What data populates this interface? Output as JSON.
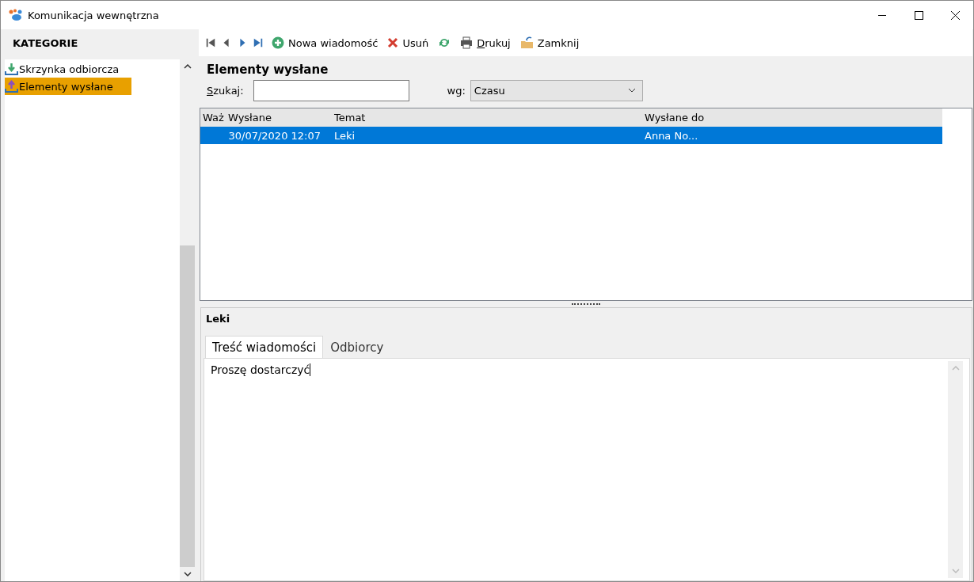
{
  "window": {
    "title": "Komunikacja wewnętrzna"
  },
  "sidebar": {
    "title": "KATEGORIE",
    "items": [
      {
        "label": "Skrzynka odbiorcza",
        "kind": "inbox",
        "selected": false
      },
      {
        "label": "Elementy wysłane",
        "kind": "sent",
        "selected": true
      }
    ]
  },
  "toolbar": {
    "items": [
      {
        "kind": "new",
        "label": "Nowa wiadomość"
      },
      {
        "kind": "delete",
        "label": "Usuń"
      },
      {
        "kind": "refresh"
      },
      {
        "kind": "print",
        "label": "Drukuj"
      },
      {
        "kind": "close",
        "label": "Zamknij"
      }
    ]
  },
  "section_title": "Elementy wysłane",
  "search": {
    "label": "Szukaj:"
  },
  "sort": {
    "label": "wg:",
    "value": "Czasu"
  },
  "table": {
    "columns": [
      "Waż",
      "Wysłane",
      "Temat",
      "Wysłane do"
    ],
    "rows": [
      {
        "sent": "30/07/2020 12:07",
        "subject": "Leki",
        "recipient": "Anna No...",
        "selected": true
      }
    ]
  },
  "detail": {
    "subject": "Leki",
    "tabs": [
      {
        "label": "Treść wiadomości",
        "selected": true
      },
      {
        "label": "Odbiorcy",
        "selected": false
      }
    ],
    "body": "Proszę dostarczyć"
  }
}
